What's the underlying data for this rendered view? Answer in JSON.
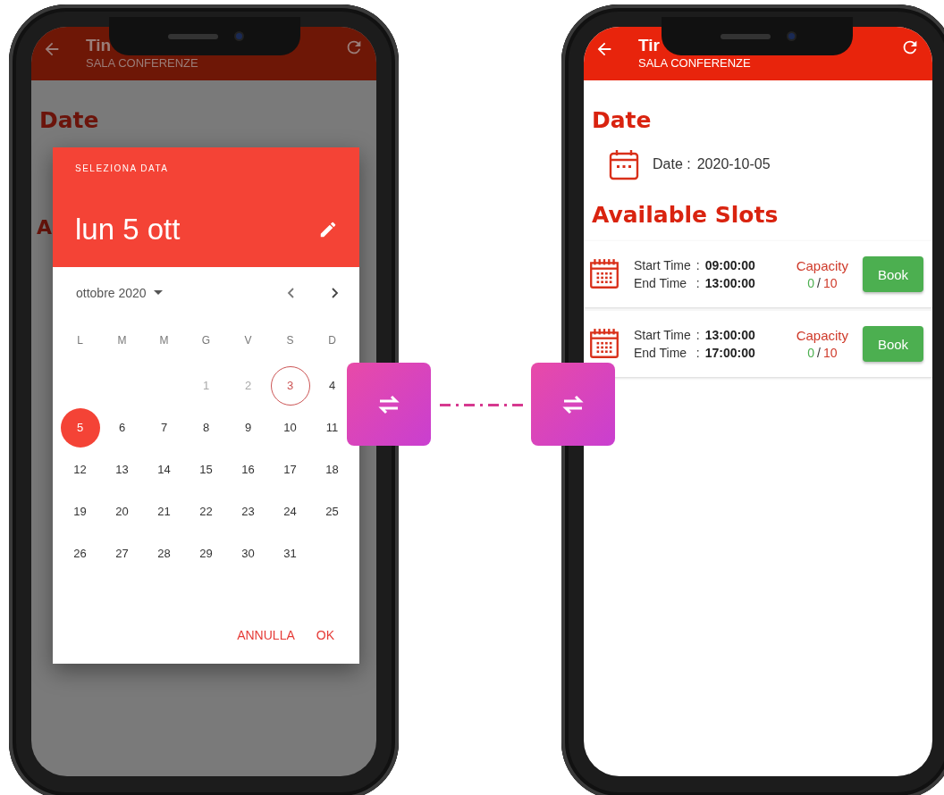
{
  "left_phone": {
    "app_bar": {
      "title": "Tin",
      "subtitle": "SALA CONFERENZE"
    },
    "headings": [
      "Date",
      "A"
    ],
    "date_picker": {
      "header_label": "SELEZIONA DATA",
      "selected_date": "lun 5 ott",
      "month_label": "ottobre 2020",
      "weekdays": [
        "L",
        "M",
        "M",
        "G",
        "V",
        "S",
        "D"
      ],
      "weeks": [
        [
          {
            "label": "1",
            "disabled": true,
            "today": false,
            "selected": false
          },
          {
            "label": "2",
            "disabled": true,
            "today": false,
            "selected": false
          },
          {
            "label": "3",
            "disabled": false,
            "today": true,
            "selected": false
          },
          {
            "label": "4",
            "disabled": false,
            "today": false,
            "selected": false
          }
        ],
        [
          {
            "label": "5",
            "disabled": false,
            "today": false,
            "selected": true
          },
          {
            "label": "6",
            "disabled": false,
            "today": false,
            "selected": false
          },
          {
            "label": "7",
            "disabled": false,
            "today": false,
            "selected": false
          },
          {
            "label": "8",
            "disabled": false,
            "today": false,
            "selected": false
          },
          {
            "label": "9",
            "disabled": false,
            "today": false,
            "selected": false
          },
          {
            "label": "10",
            "disabled": false,
            "today": false,
            "selected": false
          },
          {
            "label": "11",
            "disabled": false,
            "today": false,
            "selected": false
          }
        ],
        [
          {
            "label": "12",
            "disabled": false,
            "today": false,
            "selected": false
          },
          {
            "label": "13",
            "disabled": false,
            "today": false,
            "selected": false
          },
          {
            "label": "14",
            "disabled": false,
            "today": false,
            "selected": false
          },
          {
            "label": "15",
            "disabled": false,
            "today": false,
            "selected": false
          },
          {
            "label": "16",
            "disabled": false,
            "today": false,
            "selected": false
          },
          {
            "label": "17",
            "disabled": false,
            "today": false,
            "selected": false
          },
          {
            "label": "18",
            "disabled": false,
            "today": false,
            "selected": false
          }
        ],
        [
          {
            "label": "19",
            "disabled": false,
            "today": false,
            "selected": false
          },
          {
            "label": "20",
            "disabled": false,
            "today": false,
            "selected": false
          },
          {
            "label": "21",
            "disabled": false,
            "today": false,
            "selected": false
          },
          {
            "label": "22",
            "disabled": false,
            "today": false,
            "selected": false
          },
          {
            "label": "23",
            "disabled": false,
            "today": false,
            "selected": false
          },
          {
            "label": "24",
            "disabled": false,
            "today": false,
            "selected": false
          },
          {
            "label": "25",
            "disabled": false,
            "today": false,
            "selected": false
          }
        ],
        [
          {
            "label": "26",
            "disabled": false,
            "today": false,
            "selected": false
          },
          {
            "label": "27",
            "disabled": false,
            "today": false,
            "selected": false
          },
          {
            "label": "28",
            "disabled": false,
            "today": false,
            "selected": false
          },
          {
            "label": "29",
            "disabled": false,
            "today": false,
            "selected": false
          },
          {
            "label": "30",
            "disabled": false,
            "today": false,
            "selected": false
          },
          {
            "label": "31",
            "disabled": false,
            "today": false,
            "selected": false
          }
        ]
      ],
      "actions": [
        "ANNULLA",
        "OK"
      ]
    }
  },
  "right_phone": {
    "app_bar": {
      "title": "Tir",
      "subtitle": "SALA CONFERENZE"
    },
    "date_heading": "Date",
    "date_row": {
      "label": "Date :",
      "value": "2020-10-05"
    },
    "slots_heading": "Available Slots",
    "slots": [
      {
        "times": [
          {
            "label": "Start Time",
            "separator": ":",
            "value": "09:00:00"
          },
          {
            "label": "End Time",
            "separator": ":",
            "value": "13:00:00"
          }
        ],
        "capacity_label": "Capacity",
        "booked": "0",
        "slash": "/",
        "total": "10",
        "button": "Book"
      },
      {
        "times": [
          {
            "label": "Start Time",
            "separator": ":",
            "value": "13:00:00"
          },
          {
            "label": "End Time",
            "separator": ":",
            "value": "17:00:00"
          }
        ],
        "capacity_label": "Capacity",
        "booked": "0",
        "slash": "/",
        "total": "10",
        "button": "Book"
      }
    ]
  }
}
